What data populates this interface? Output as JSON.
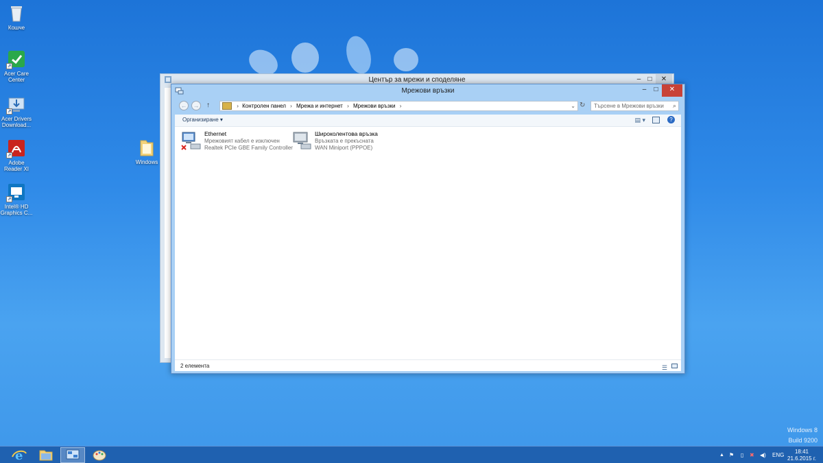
{
  "desktop": {
    "icons": [
      {
        "label": "Кошче"
      },
      {
        "label": "Acer Care Center"
      },
      {
        "label": "Acer Drivers Download..."
      },
      {
        "label": "Adobe Reader XI"
      },
      {
        "label": "Intel® HD Graphics C..."
      },
      {
        "label": "Windows"
      }
    ],
    "watermark": {
      "line1": "Windows 8",
      "line2": "Build 9200"
    }
  },
  "back_window": {
    "title": "Център за мрежи и споделяне"
  },
  "window": {
    "title": "Мрежови връзки",
    "controls": {
      "minimize": "–",
      "maximize": "□",
      "close": "✕"
    },
    "breadcrumb": [
      "Контролен панел",
      "Мрежа и интернет",
      "Мрежови връзки"
    ],
    "breadcrumb_sep": "›",
    "search_placeholder": "Търсене в Мрежови връзки",
    "toolbar": {
      "organize": "Организиране ▾"
    },
    "items": [
      {
        "name": "Ethernet",
        "status": "Мрежовият кабел е изключен",
        "device": "Realtek PCIe GBE Family Controller"
      },
      {
        "name": "Широколентова връзка",
        "status": "Връзката е прекъсната",
        "device": "WAN Miniport (PPPOE)"
      }
    ],
    "status_text": "2 елемента"
  },
  "taskbar": {
    "tray": {
      "lang": "ENG",
      "time": "18:41",
      "date": "21.6.2015 г."
    }
  },
  "colors": {
    "accent": "#1d74d8",
    "close": "#c84237",
    "titlebar": "#a9d0f5"
  }
}
